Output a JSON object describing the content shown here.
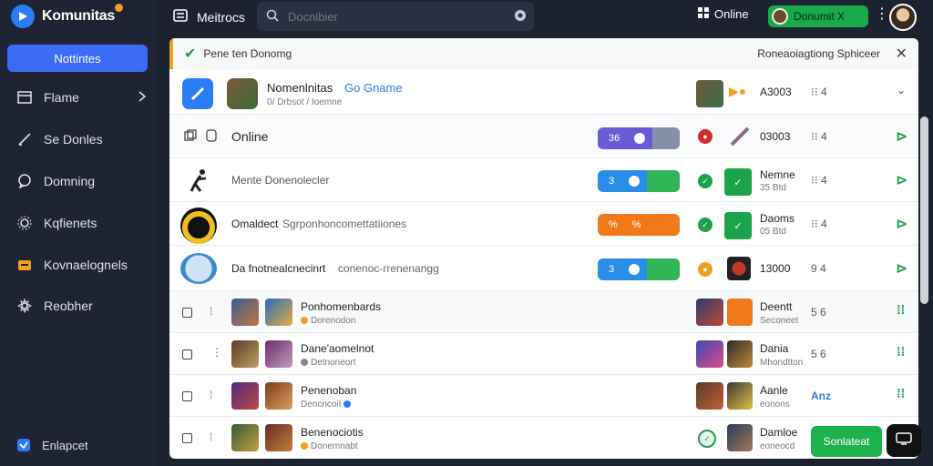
{
  "app": {
    "name": "Komunitas"
  },
  "sidebar": {
    "primary": "Nottintes",
    "items": [
      {
        "label": "Flame",
        "icon": "frame-icon"
      },
      {
        "label": "Se Donles",
        "icon": "pen-icon"
      },
      {
        "label": "Domning",
        "icon": "chat-icon"
      },
      {
        "label": "Kqfienets",
        "icon": "gear-icon"
      },
      {
        "label": "Kovnaelognels",
        "icon": "folder-icon"
      },
      {
        "label": "Reobher",
        "icon": "settings-icon"
      }
    ],
    "bottom": "Enlapcet"
  },
  "topbar": {
    "menu": "Meitrocs",
    "search_placeholder": "Docnibier",
    "online": "Online",
    "connect": "Donumit X"
  },
  "notice": {
    "text": "Pene ten Donomg",
    "right": "Roneaoiagtiong Sphiceer"
  },
  "rows": [
    {
      "title": "Nomenlnitas",
      "title_accent": "Go Gname",
      "sub": "0/ Drbsot / Ioemne",
      "num": "A3003",
      "mini": "⁝⁝ 4"
    },
    {
      "title": "Online",
      "toggle": "36",
      "num": "03003",
      "mini": "⁝⁝ 4"
    },
    {
      "title": "Mente Donenolecler",
      "toggle": "3",
      "num": "Nemne",
      "num_sub": "35 Btd",
      "mini": "⁝⁝ 4"
    },
    {
      "title": "Omaldect",
      "sub_inline": "Sgrponhoncomettatiiones",
      "toggle": "%",
      "num": "Daoms",
      "num_sub": "05 Btd",
      "mini": "⁝⁝ 4"
    },
    {
      "title": "Da fnotnealcnecinrt",
      "sub_inline": "conenoc-rrenenangg",
      "toggle": "3",
      "num": "13000",
      "mini": "9 4"
    }
  ],
  "list": [
    {
      "title": "Ponhomenbards",
      "sub": "Dorenodon",
      "right": "Deentt",
      "right_sub": "Seconeet",
      "mini": "5 6"
    },
    {
      "title": "Dane'aomelnot",
      "sub": "Detnoneort",
      "right": "Dania",
      "right_sub": "Mhondtton",
      "mini": "5 6"
    },
    {
      "title": "Penenoban",
      "sub": "Dencncoit",
      "right": "Aanle",
      "right_sub": "eonons",
      "mini": "Anz"
    },
    {
      "title": "Benenociotis",
      "sub": "Donemnabt",
      "right": "Damloe",
      "right_sub": "eoneocd",
      "mini": ""
    }
  ],
  "actions": {
    "green": "Sonlateat"
  }
}
